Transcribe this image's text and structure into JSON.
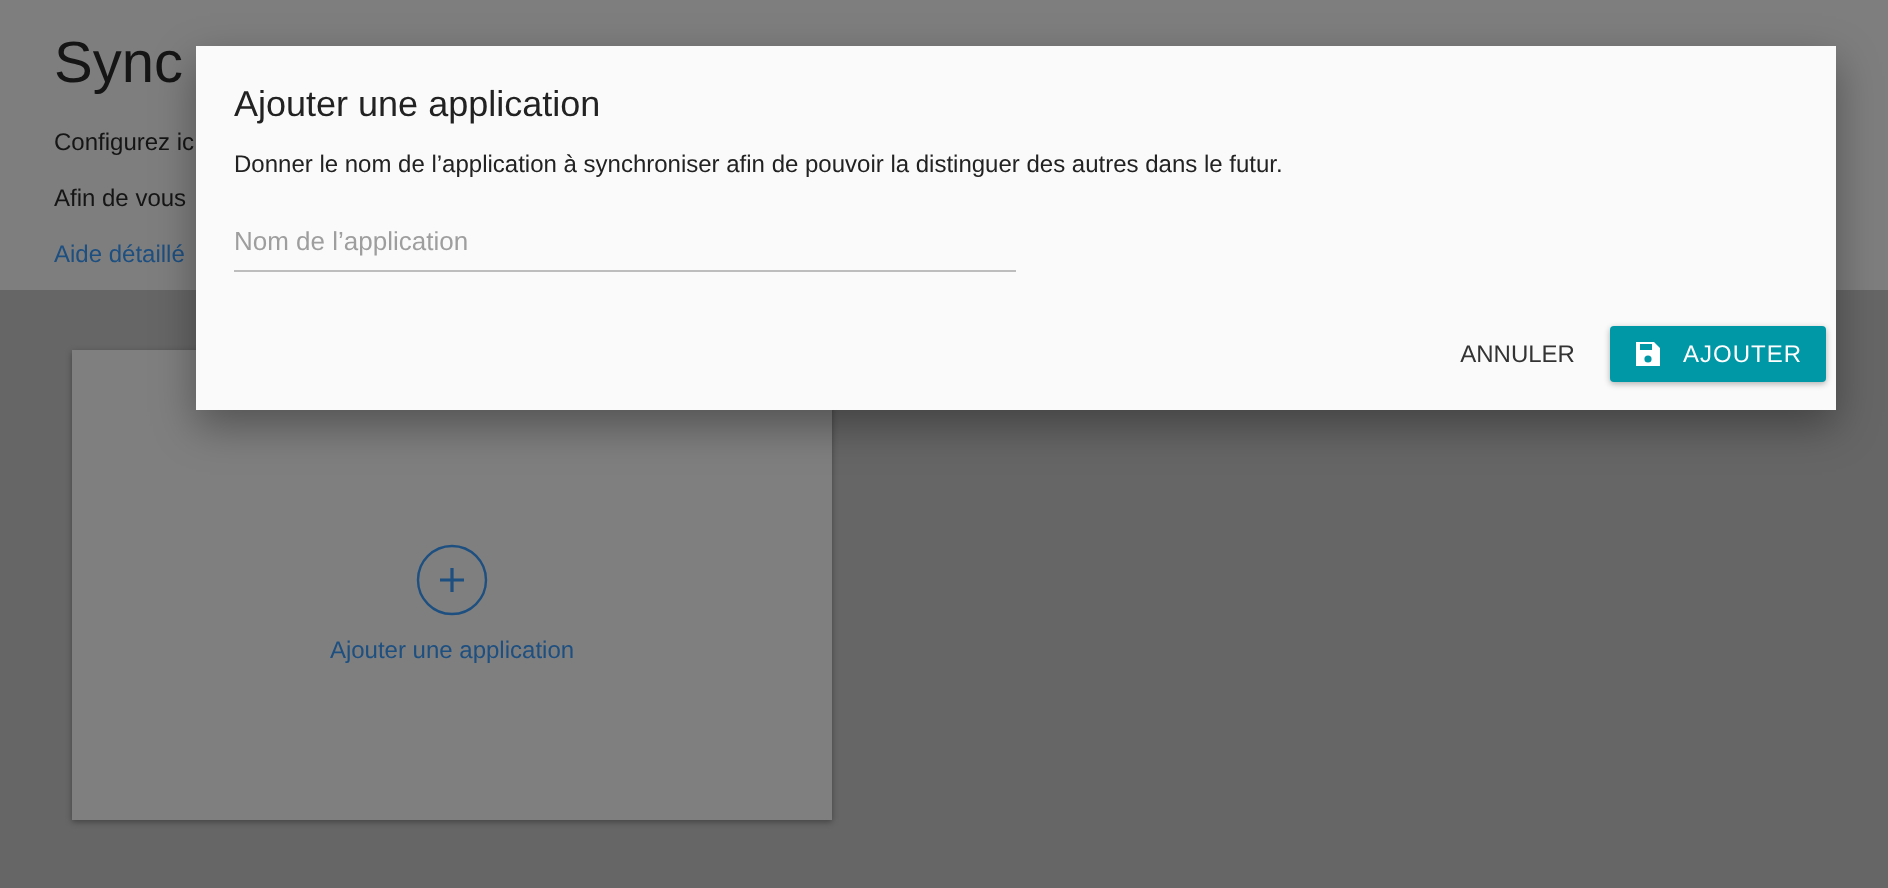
{
  "page": {
    "title": "Sync",
    "lines": [
      "Configurez ic",
      "Afin de vous"
    ],
    "help_link": "Aide détaillé"
  },
  "add_card": {
    "label": "Ajouter une application"
  },
  "dialog": {
    "title": "Ajouter une application",
    "description": "Donner le nom de l’application à synchroniser afin de pouvoir la distinguer des autres dans le futur.",
    "field": {
      "placeholder": "Nom de l’application"
    },
    "buttons": [
      {
        "kind": "text",
        "label": "ANNULER"
      },
      {
        "kind": "primary",
        "label": "AJOUTER"
      }
    ]
  }
}
